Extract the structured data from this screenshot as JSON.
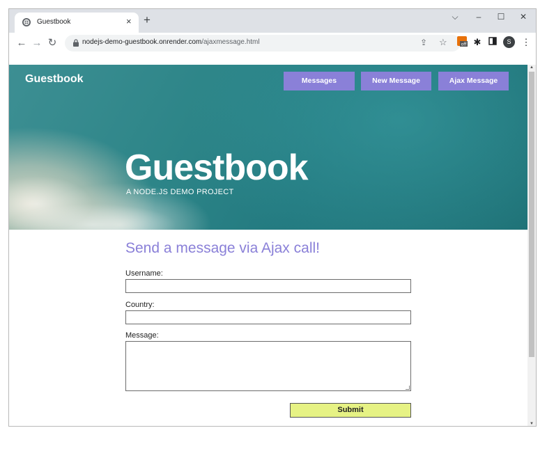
{
  "browser": {
    "tab_title": "Guestbook",
    "tab_close": "×",
    "new_tab": "+",
    "url_host": "nodejs-demo-guestbook.onrender.com",
    "url_path": "/ajaxmessage.html",
    "profile_initial": "S",
    "window_controls": {
      "dropdown": "⌵",
      "minimize": "–",
      "maximize": "☐",
      "close": "✕"
    },
    "nav_icons": {
      "back": "←",
      "forward": "→",
      "reload": "↻"
    },
    "extension_badge": "off"
  },
  "site": {
    "brand": "Guestbook",
    "nav": [
      "Messages",
      "New Message",
      "Ajax Message"
    ],
    "hero_title": "Guestbook",
    "hero_subtitle": "A NODE.JS DEMO PROJECT"
  },
  "form": {
    "title": "Send a message via Ajax call!",
    "username_label": "Username:",
    "country_label": "Country:",
    "message_label": "Message:",
    "username_value": "",
    "country_value": "",
    "message_value": "",
    "submit_label": "Submit"
  },
  "colors": {
    "accent": "#8a80d8",
    "submit_bg": "#e6f284",
    "hero_teal": "#2d8588"
  }
}
